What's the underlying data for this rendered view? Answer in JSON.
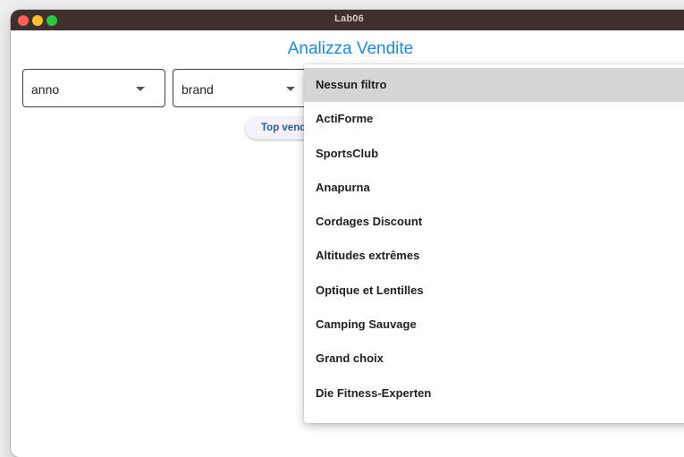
{
  "window": {
    "title": "Lab06"
  },
  "header": {
    "title": "Analizza Vendite"
  },
  "filters": {
    "anno": {
      "value": "anno"
    },
    "brand": {
      "value": "brand"
    }
  },
  "actions": {
    "top_sales_label": "Top vendite"
  },
  "brand_dropdown": {
    "selected_index": 0,
    "items": [
      {
        "label": "Nessun filtro"
      },
      {
        "label": "ActiForme"
      },
      {
        "label": "SportsClub"
      },
      {
        "label": "Anapurna"
      },
      {
        "label": "Cordages Discount"
      },
      {
        "label": "Altitudes extrêmes"
      },
      {
        "label": "Optique et Lentilles"
      },
      {
        "label": "Camping Sauvage"
      },
      {
        "label": "Grand choix"
      },
      {
        "label": "Die Fitness-Experten"
      }
    ]
  },
  "colors": {
    "title_accent": "#1e88e5",
    "titlebar": "#3d302d",
    "selected_item_bg": "#d5d5d5"
  }
}
